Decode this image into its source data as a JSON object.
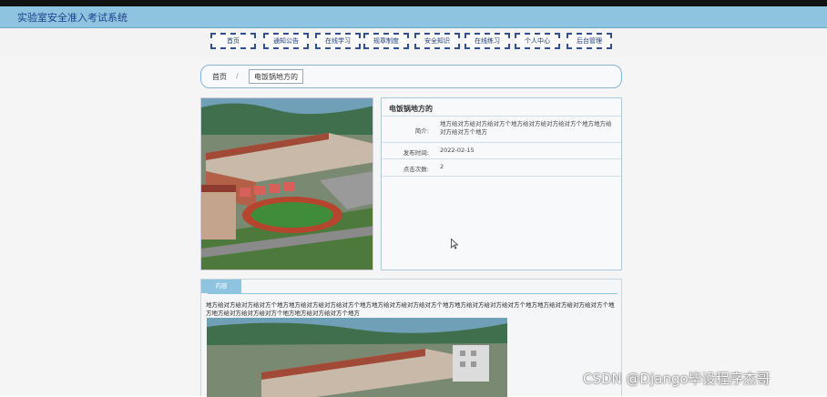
{
  "header": {
    "title": "实验室安全准入考试系统"
  },
  "nav": {
    "items": [
      "首页",
      "通知公告",
      "在线学习",
      "规章制度",
      "安全知识",
      "在线练习",
      "个人中心",
      "后台管理"
    ]
  },
  "breadcrumb": {
    "home": "首页",
    "separator": "/",
    "current": "电饭锅地方的"
  },
  "detail": {
    "title": "电饭锅地方的",
    "intro_label": "简介:",
    "intro_value": "地方给对方给对方给对方个地方给对方给对方给对方个地方地方给对方给对方个地方",
    "publish_label": "发布时间:",
    "publish_value": "2022-02-15",
    "clicks_label": "点击次数:",
    "clicks_value": "2"
  },
  "content": {
    "tab_label": "内容",
    "text": "地方给对方给对方给对方个地方地方给对方给对方给对方个地方地方给对方给对方给对方个地方地方给对方给对方给对方个地方地方给对方给对方给对方个地方地方给对方给对方给对方个地方地方给对方给对方个地方"
  },
  "watermark": "CSDN @Django毕设程序杰哥",
  "colors": {
    "titlebar": "#8ec4df",
    "nav_border": "#2f4f8f",
    "accent": "#8ec4df"
  }
}
